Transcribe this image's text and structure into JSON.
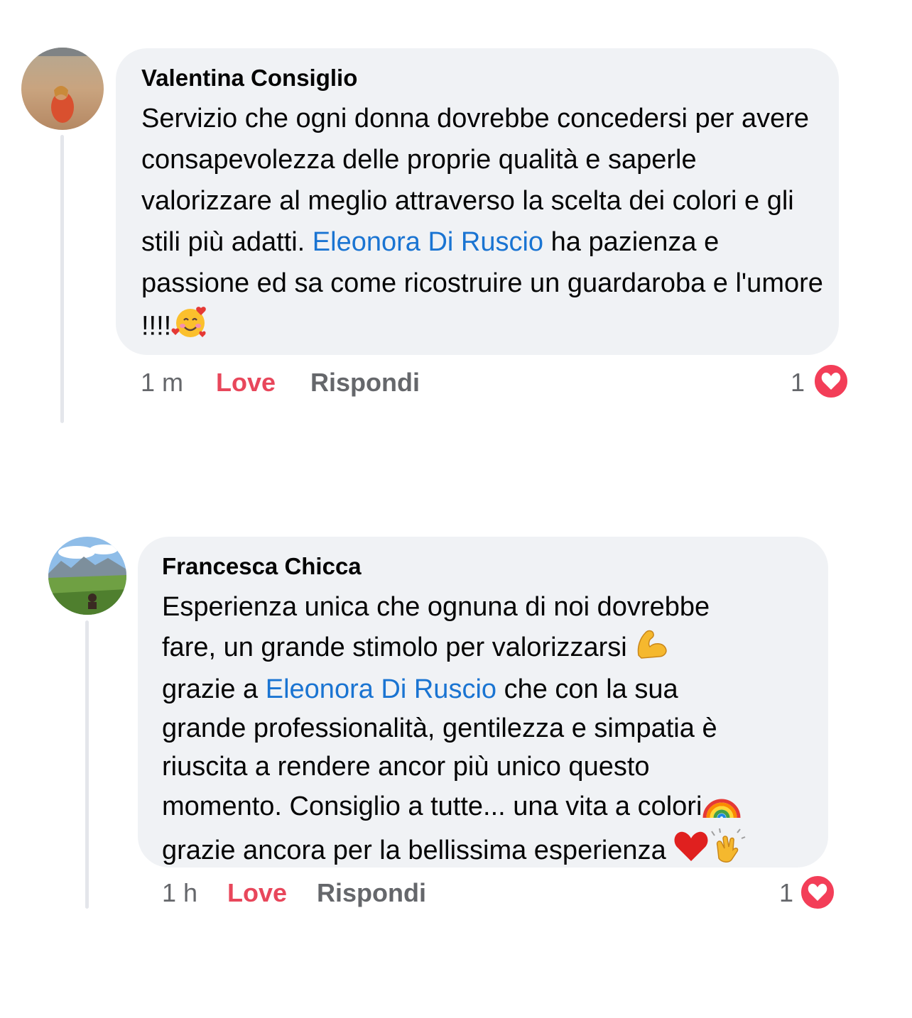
{
  "comments": [
    {
      "author": "Valentina Consiglio",
      "text_before": "Servizio che ogni donna dovrebbe concedersi per avere consapevolezza delle proprie qualità e saperle valorizzare al meglio attraverso la scelta dei colori e gli stili più adatti. ",
      "mention": "Eleonora Di Ruscio",
      "text_after": " ha pazienza e passione ed sa come ricostruire un guardaroba e l'umore !!!!",
      "emoji_end": "smiling-face-with-hearts-icon",
      "time": "1 m",
      "love_label": "Love",
      "reply_label": "Rispondi",
      "reaction_count": "1"
    },
    {
      "author": "Francesca Chicca",
      "line1": "Esperienza unica che ognuna di noi dovrebbe",
      "line2": "fare, un grande stimolo per valorizzarsi",
      "line3_before": "grazie a ",
      "mention": "Eleonora Di Ruscio",
      "line3_after": " che con la sua",
      "line4": "grande professionalità, gentilezza e simpatia è",
      "line5": "riuscita a rendere ancor più unico questo",
      "line6": "momento. Consiglio a tutte... una vita a colori",
      "line7": "grazie ancora per la bellissima esperienza",
      "time": "1 h",
      "love_label": "Love",
      "reply_label": "Rispondi",
      "reaction_count": "1"
    }
  ],
  "colors": {
    "bubble": "#f0f2f5",
    "mention": "#1a74d2",
    "love": "#e8475b",
    "muted": "#65676b",
    "heart": "#f33e58"
  }
}
